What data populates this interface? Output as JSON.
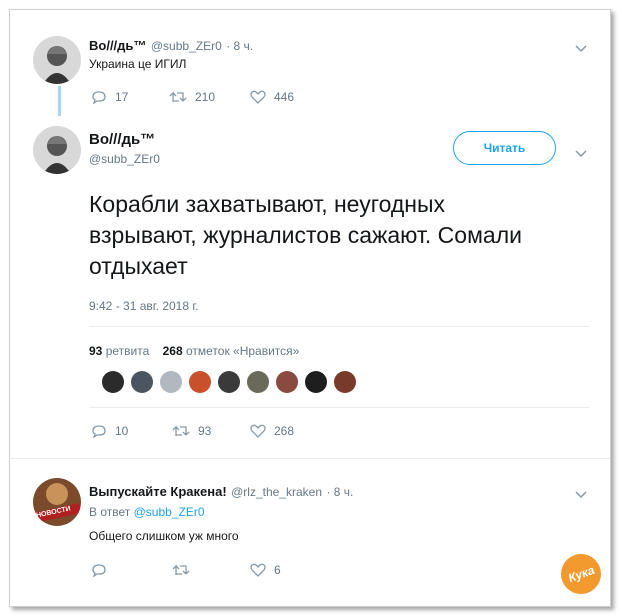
{
  "tweet1": {
    "display_name": "Во///дь™",
    "handle": "@subb_ZEr0",
    "time": "· 8 ч.",
    "text": "Украина це ИГИЛ",
    "replies": "17",
    "retweets": "210",
    "likes": "446"
  },
  "main_tweet": {
    "display_name": "Во///дь™",
    "handle": "@subb_ZEr0",
    "follow_label": "Читать",
    "text": "Корабли захватывают, неугодных взрывают, журналистов сажают. Сомали отдыхает",
    "timestamp": "9:42 - 31 авг. 2018 г.",
    "retweet_count": "93",
    "retweet_label": "ретвита",
    "like_count": "268",
    "like_label": "отметок «Нравится»",
    "replies": "10",
    "retweets": "93",
    "likes": "268",
    "liker_avatar_colors": [
      "#2b2b2b",
      "#4a5560",
      "#b0b8c0",
      "#c8502a",
      "#3a3a3a",
      "#6a6a5a",
      "#8a4a40",
      "#1e1e1e",
      "#7a3a2a"
    ]
  },
  "reply": {
    "display_name": "Выпускайте Кракена!",
    "handle": "@rlz_the_kraken",
    "time": "· 8 ч.",
    "in_reply_prefix": "В ответ",
    "in_reply_handle": "@subb_ZEr0",
    "avatar_text": "НОВОСТИ",
    "text": "Общего слишком уж много",
    "likes": "6"
  },
  "watermark": {
    "text": "Кука"
  },
  "colors": {
    "accent": "#1da1f2",
    "muted": "#657786",
    "thread_line": "#a8d4f5"
  }
}
